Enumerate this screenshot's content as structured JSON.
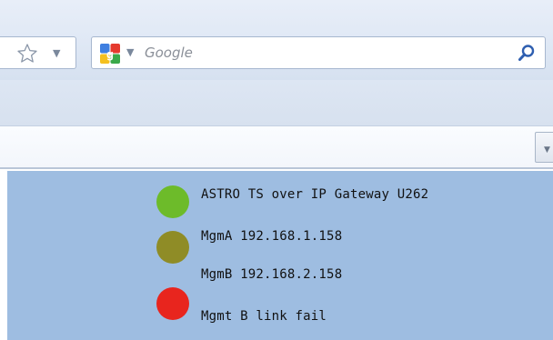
{
  "browser": {
    "search": {
      "placeholder": "Google"
    },
    "icons": {
      "bookmark_star": "star-icon",
      "url_dropdown": "chevron-down-icon",
      "search_engine": "google-icon",
      "engine_dropdown": "chevron-down-icon",
      "search_go": "magnifier-icon",
      "tab_list": "chevron-down-icon"
    }
  },
  "status_panel": {
    "background": "#9ebde1",
    "items": [
      {
        "label": "ASTRO TS over IP Gateway U262",
        "color": "#6dbb2a"
      },
      {
        "label": "MgmA 192.168.1.158",
        "color": "#8f8c26"
      },
      {
        "label": "MgmB 192.168.2.158",
        "color": "#8f8c26"
      },
      {
        "label": "Mgmt B link fail",
        "color": "#e8251e"
      }
    ]
  }
}
